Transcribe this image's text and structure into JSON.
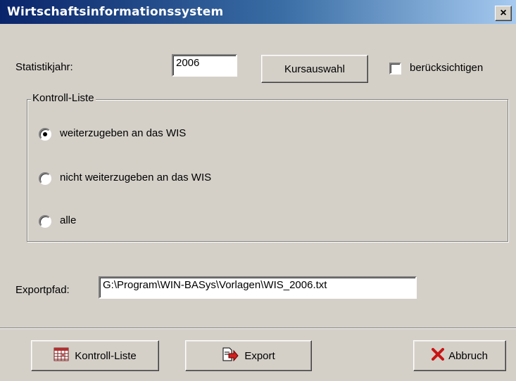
{
  "window": {
    "title": "Wirtschaftsinformationssystem",
    "close_label": "×"
  },
  "form": {
    "year_label": "Statistikjahr:",
    "year_value": "2006",
    "course_button": "Kursauswahl",
    "consider_label": "berücksichtigen",
    "consider_checked": false,
    "export_path_label": "Exportpfad:",
    "export_path_value": "G:\\Program\\WIN-BASys\\Vorlagen\\WIS_2006.txt"
  },
  "control_list": {
    "group_label": "Kontroll-Liste",
    "options": [
      {
        "label": "weiterzugeben an das WIS",
        "selected": true
      },
      {
        "label": "nicht weiterzugeben an das WIS",
        "selected": false
      },
      {
        "label": "alle",
        "selected": false
      }
    ]
  },
  "footer": {
    "control_list_button": "Kontroll-Liste",
    "export_button": "Export",
    "cancel_button": "Abbruch"
  },
  "icons": {
    "control_list": "calendar-grid-icon",
    "export": "document-arrow-icon",
    "cancel": "red-x-icon"
  }
}
